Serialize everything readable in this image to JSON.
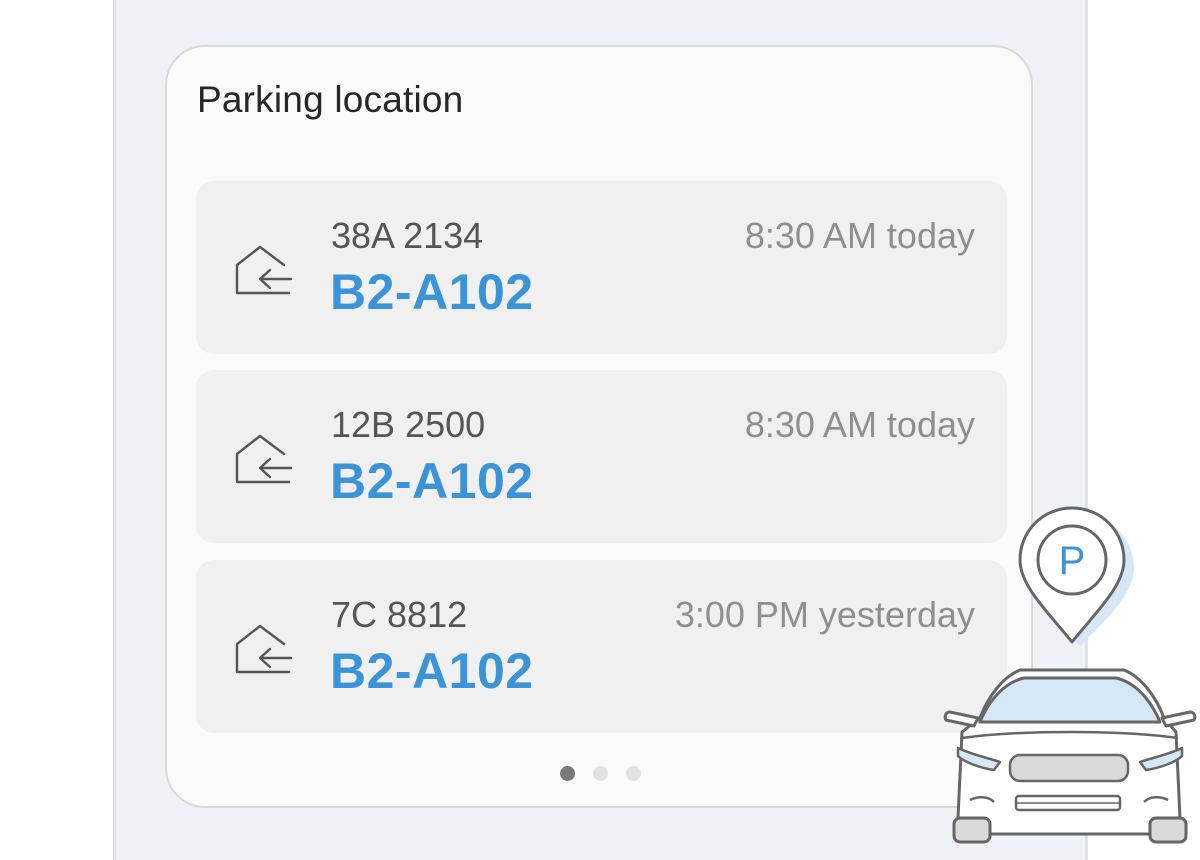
{
  "card": {
    "title": "Parking location"
  },
  "entries": [
    {
      "plate": "38A 2134",
      "spot": "B2-A102",
      "time": "8:30 AM today",
      "icon": "exit-home-icon"
    },
    {
      "plate": "12B 2500",
      "spot": "B2-A102",
      "time": "8:30 AM today",
      "icon": "exit-home-icon"
    },
    {
      "plate": "7C 8812",
      "spot": "B2-A102",
      "time": "3:00 PM yesterday",
      "icon": "exit-home-icon"
    }
  ],
  "pager": {
    "count": 3,
    "active_index": 0
  },
  "illustration": {
    "pin_letter": "P",
    "icon": "parking-car-illustration"
  },
  "colors": {
    "accent": "#3b93d8",
    "panel_bg": "#eef2f6",
    "card_bg": "#fafafa",
    "entry_bg": "#f0f0f0",
    "plate_text": "#555555",
    "time_text": "#8f8f8f"
  }
}
